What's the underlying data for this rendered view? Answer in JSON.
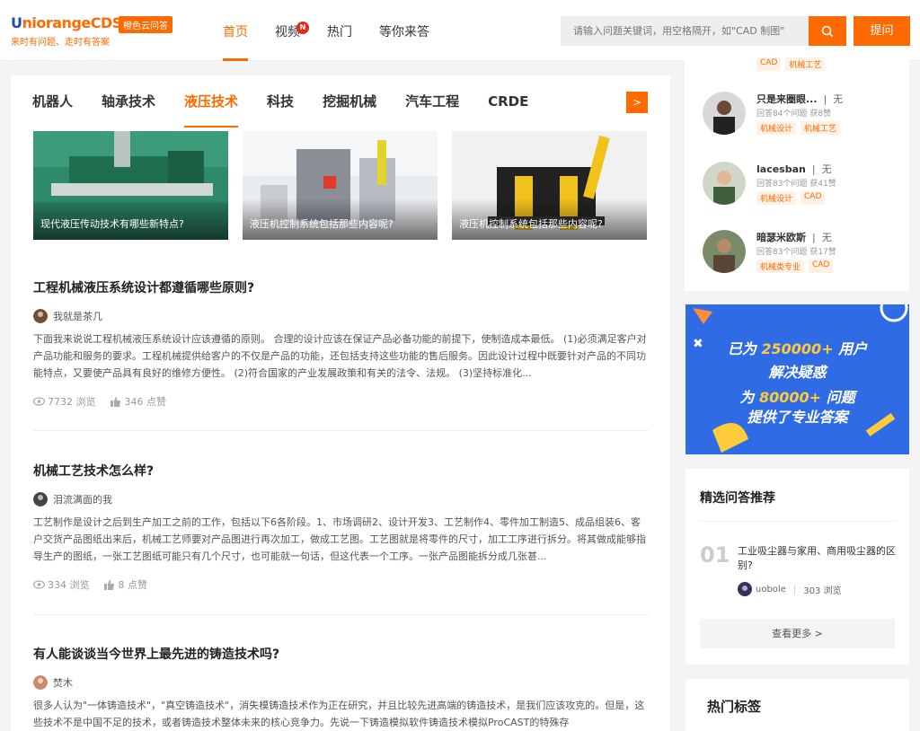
{
  "header": {
    "logo": {
      "prefix": "U",
      "name": "niorangeCDS",
      "badge": "橙色云问答",
      "slogan": "来时有问题、走时有答案"
    },
    "nav": [
      {
        "label": "首页",
        "active": true
      },
      {
        "label": "视频",
        "badge": "N"
      },
      {
        "label": "热门"
      },
      {
        "label": "等你来答"
      }
    ],
    "search": {
      "placeholder": "请输入问题关键词，用空格隔开，如\"CAD 制图\""
    },
    "ask_label": "提问"
  },
  "main": {
    "tabs": [
      "机器人",
      "轴承技术",
      "液压技术",
      "科技",
      "挖掘机械",
      "汽车工程",
      "CRDE"
    ],
    "active_tab": "液压技术",
    "tab_next": ">",
    "thumbs": [
      {
        "caption": "现代液压传动技术有哪些新特点?"
      },
      {
        "caption": "液压机控制系统包括那些内容呢?"
      },
      {
        "caption": "液压机控制系统包括那些内容呢?"
      }
    ],
    "articles": [
      {
        "title": "工程机械液压系统设计都遵循哪些原则?",
        "author": "我就是茶几",
        "body": "下面我来说说工程机械液压系统设计应该遵循的原则。 合理的设计应该在保证产品必备功能的前提下，使制造成本最低。 (1)必须满足客户对产品功能和服务的要求。工程机械提供给客户的不仅是产品的功能，还包括支持这些功能的售后服务。因此设计过程中既要针对产品的不同功能特点，又要使产品具有良好的维修方便性。 (2)符合国家的产业发展政策和有关的法令、法规。 (3)坚持标准化...",
        "views": "7732 浏览",
        "likes": "346 点赞"
      },
      {
        "title": "机械工艺技术怎么样?",
        "author": "泪流满面的我",
        "body": "工艺制作是设计之后到生产加工之前的工作，包括以下6各阶段。1、市场调研2、设计开发3、工艺制作4、零件加工制造5、成品组装6、客户交货产品图纸出来后，机械工艺师要对产品图进行再次加工，做成工艺图。工艺图就是将零件的尺寸，加工工序进行拆分。将其做成能够指导生产的图纸，一张工艺图纸可能只有几个尺寸，也可能就一句话，但这代表一个工序。一张产品图能拆分成几张甚...",
        "views": "334 浏览",
        "likes": "8 点赞"
      },
      {
        "title": "有人能谈谈当今世界上最先进的铸造技术吗?",
        "author": "焚木",
        "body": "很多人认为\"一体铸造技术\"，\"真空铸造技术\"，消失模铸造技术作为正在研究，并且比较先进高端的铸造技术，是我们应该攻克的。但是，这些技术不是中国不足的技术，或者铸造技术整体未来的核心竞争力。先说一下铸造模拟软件铸造技术模拟ProCAST的特殊存",
        "views": "",
        "likes": ""
      }
    ]
  },
  "sidebar": {
    "top_tags": [
      "CAD",
      "机械工艺"
    ],
    "users": [
      {
        "name": "只是来圈眼...",
        "extra": "无",
        "meta": "回答84个问题   获8赞",
        "tags": [
          "机械设计",
          "机械工艺"
        ]
      },
      {
        "name": "lacesban",
        "extra": "无",
        "meta": "回答83个问题   获41赞",
        "tags": [
          "机械设计",
          "CAD"
        ]
      },
      {
        "name": "暗瑟米欧斯",
        "extra": "无",
        "meta": "回答83个问题   获17赞",
        "tags": [
          "机械类专业",
          "CAD"
        ]
      }
    ],
    "banner": {
      "line1_pre": "已为 ",
      "line1_num": "250000+",
      "line1_post": " 用户",
      "line2": "解决疑惑",
      "line3_pre": "为 ",
      "line3_num": "80000+",
      "line3_post": " 问题",
      "line4": "提供了专业答案"
    },
    "picks": {
      "title": "精选问答推荐",
      "items": [
        {
          "num": "01",
          "title": "工业吸尘器与家用、商用吸尘器的区别?",
          "author": "uobole",
          "views": "303 浏览"
        }
      ],
      "more_label": "查看更多 >"
    },
    "hot_tags_title": "热门标签"
  },
  "colors": {
    "accent": "#ff6a00",
    "banner_blue": "#2f6be4",
    "banner_yellow": "#ffcb3b"
  }
}
